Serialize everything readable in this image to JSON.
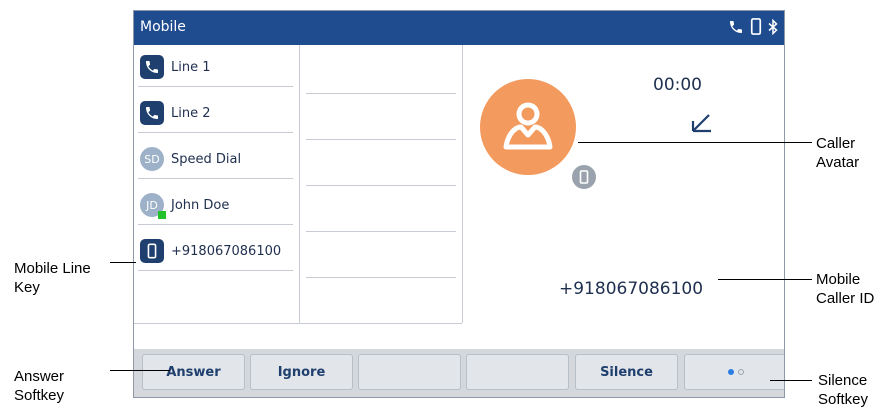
{
  "title_bar": {
    "title": "Mobile",
    "icons": [
      "phone-icon",
      "mobile-device-icon",
      "bluetooth-icon"
    ]
  },
  "line_keys": [
    {
      "label": "Line 1",
      "icon": "phone-icon"
    },
    {
      "label": "Line 2",
      "icon": "phone-icon"
    },
    {
      "label": "Speed Dial",
      "initials": "SD"
    },
    {
      "label": "John Doe",
      "initials": "JD",
      "presence": "available"
    },
    {
      "label": "+918067086100",
      "icon": "mobile-device-icon"
    }
  ],
  "call": {
    "timer": "00:00",
    "direction_icon": "incoming-arrow-icon",
    "caller_id": "+918067086100",
    "avatar_icon": "person-icon",
    "avatar_badge_icon": "mobile-device-icon"
  },
  "softkeys": [
    "Answer",
    "Ignore",
    "",
    "",
    "Silence",
    ""
  ],
  "pager": {
    "current": 1,
    "total": 2
  },
  "callouts": {
    "caller_avatar": "Caller Avatar",
    "mobile_line_key": "Mobile Line Key",
    "mobile_caller_id": "Mobile Caller ID",
    "answer_softkey": "Answer Softkey",
    "silence_softkey": "Silence Softkey"
  },
  "colors": {
    "title_bar": "#1f4b8f",
    "avatar": "#f39a5e",
    "presence": "#22c22a",
    "pager_active": "#2a7de1"
  }
}
